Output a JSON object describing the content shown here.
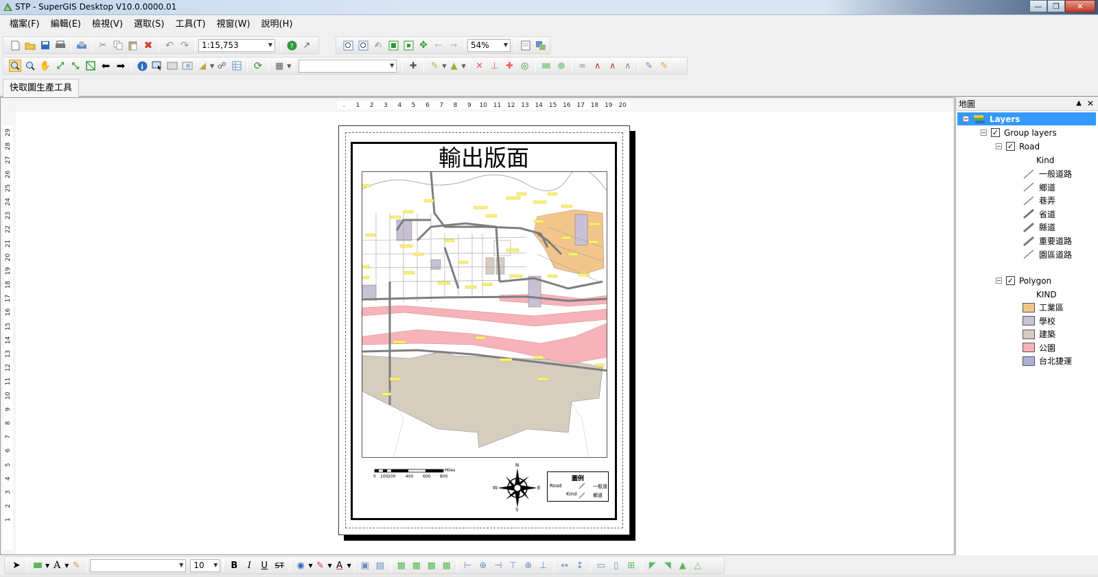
{
  "window": {
    "title": "STP - SuperGIS Desktop V10.0.0000.01"
  },
  "menu": [
    "檔案(F)",
    "編輯(E)",
    "檢視(V)",
    "選取(S)",
    "工具(T)",
    "視窗(W)",
    "說明(H)"
  ],
  "toolbar": {
    "scale_value": "1:15,753",
    "zoom_value": "54%",
    "font_size": "10"
  },
  "tab": {
    "label": "快取圖生產工具"
  },
  "layout": {
    "title": "輸出版面",
    "ruler_h": [
      ".",
      "1",
      "2",
      "3",
      "4",
      "5",
      "6",
      "7",
      "8",
      "9",
      "10",
      "11",
      "12",
      "13",
      "14",
      "15",
      "16",
      "17",
      "18",
      "19",
      "20"
    ],
    "ruler_v": [
      "29",
      "28",
      "27",
      "26",
      "25",
      "24",
      "23",
      "22",
      "21",
      "20",
      "19",
      "18",
      "17",
      "16",
      "15",
      "14",
      "13",
      "12",
      "11",
      "10",
      "9",
      "8",
      "7",
      "6",
      "5",
      "4",
      "3",
      "2",
      "1"
    ],
    "scale_labels": [
      "0",
      "100",
      "200",
      "400",
      "600",
      "800"
    ],
    "scale_unit": "Miles",
    "north": {
      "n": "N",
      "s": "S",
      "e": "E",
      "w": "W"
    },
    "legend": {
      "title": "圖例",
      "layer": "Road",
      "field": "Kind",
      "items": [
        "一般道",
        "鄉道"
      ]
    }
  },
  "panel": {
    "title": "地圖",
    "root": "Layers",
    "group": "Group layers",
    "road": {
      "name": "Road",
      "field": "Kind",
      "items": [
        "一般道路",
        "鄉道",
        "巷弄",
        "省道",
        "縣道",
        "重要道路",
        "園區道路"
      ]
    },
    "polygon": {
      "name": "Polygon",
      "field": "KIND",
      "items": [
        {
          "label": "工業區",
          "color": "#f2c68b"
        },
        {
          "label": "學校",
          "color": "#c8c0d4"
        },
        {
          "label": "建築",
          "color": "#d6cdbf"
        },
        {
          "label": "公園",
          "color": "#f7b3b9"
        },
        {
          "label": "台北捷運",
          "color": "#a9b1d6"
        }
      ]
    }
  }
}
